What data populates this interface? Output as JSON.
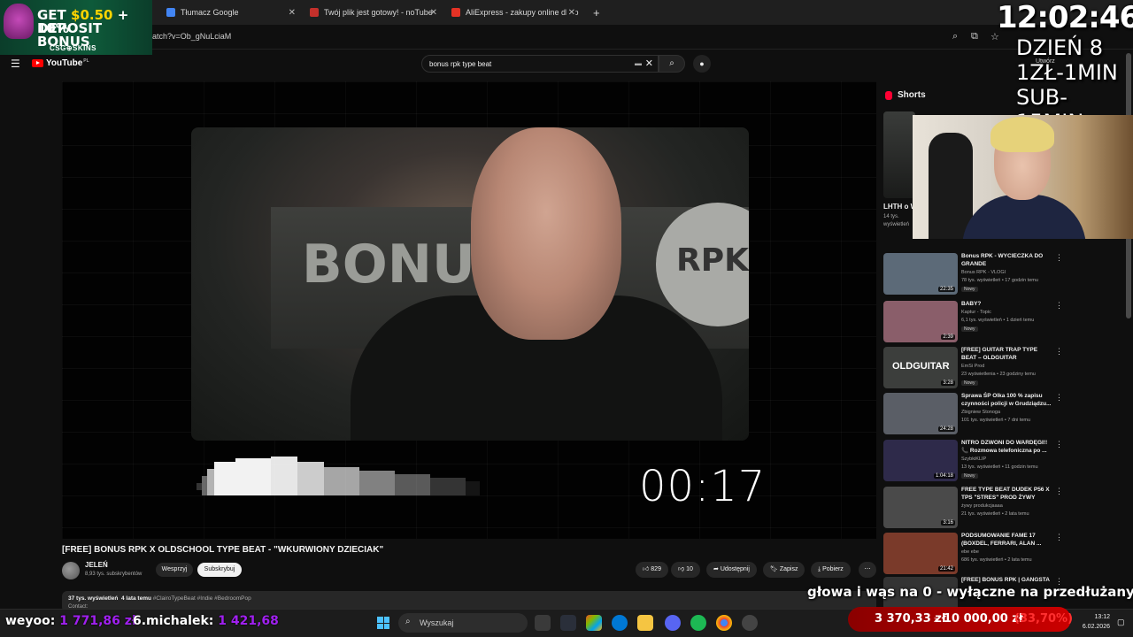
{
  "browser": {
    "tabs": [
      {
        "label": "Tłumacz Google",
        "color": "#4285f4"
      },
      {
        "label": "Twój plik jest gotowy! - noTube",
        "color": "#c4302b"
      },
      {
        "label": "AliExpress - zakupy online dla p",
        "color": "#e43225"
      }
    ],
    "url": "atch?v=Ob_gNuLciaM"
  },
  "youtube": {
    "logo": "YouTube",
    "region": "PL",
    "search_query": "bonus rpk type beat",
    "create_label": "Utwórz"
  },
  "player": {
    "timer": "00:17",
    "graffiti_left": "BONUS",
    "graffiti_right": "RPK"
  },
  "video": {
    "title": "[FREE] BONUS RPK X OLDSCHOOL TYPE BEAT - \"WKURWIONY DZIECIAK\"",
    "channel": "JELEŃ",
    "subscribers": "8,93 tys. subskrybentów",
    "join_label": "Wesprzyj",
    "subscribe_label": "Subskrybuj",
    "likes": "829",
    "dislikes": "10",
    "share_label": "Udostępnij",
    "save_label": "Zapisz",
    "download_label": "Pobierz",
    "more_label": "⋯",
    "views": "37 tys. wyświetleń",
    "age": "4 lata temu",
    "tags": "#ClairoTypeBeat #Indie #BedroomPop",
    "contact": "Contact:"
  },
  "sidebar": {
    "shorts_label": "Shorts",
    "short": {
      "title": "LHTH o W",
      "views": "14 tys. wyświetleń"
    },
    "recommendations": [
      {
        "title": "Bonus RPK - WYCIECZKA DO GRANDE",
        "channel": "Bonus RPK - VLOGI",
        "meta": "78 tys. wyświetleń • 17 godzin temu",
        "badge": "Nowy",
        "duration": "22:35",
        "thumb": "#5c6a78"
      },
      {
        "title": "BABY?",
        "channel": "Kaptur - Topic",
        "meta": "6,1 tys. wyświetleń • 1 dzień temu",
        "badge": "Nowy",
        "duration": "2:39",
        "thumb": "#8a5e6a"
      },
      {
        "title": "[FREE] GUITAR TRAP TYPE BEAT – OLDGUITAR",
        "channel": "EmSi Prod",
        "meta": "23 wyświetlenia • 23 godziny temu",
        "badge": "Nowy",
        "duration": "3:28",
        "thumb": "#3c3e3c",
        "thumb_text": "OLDGUITAR"
      },
      {
        "title": "Sprawa ŚP Olka 100 % zapisu czynności policji w Grudziądzu...",
        "channel": "Zbigniew Stonoga",
        "meta": "101 tys. wyświetleń • 7 dni temu",
        "badge": "",
        "duration": "24:28",
        "thumb": "#5a5e66"
      },
      {
        "title": "NITRO DZWONI DO WARDĘGI!! 📞 Rozmowa telefoniczna po ...",
        "channel": "SzybkiKLIP",
        "meta": "13 tys. wyświetleń • 11 godzin temu",
        "badge": "Nowy",
        "duration": "1:04:18",
        "thumb": "#2e2a4a"
      },
      {
        "title": "FREE TYPE BEAT DUDEK P56 X TPS \"STRES\" PROD ŻYWY",
        "channel": "żywy produkcjaaaa",
        "meta": "21 tys. wyświetleń • 2 lata temu",
        "badge": "",
        "duration": "3:16",
        "thumb": "#4a4a4a"
      },
      {
        "title": "PODSUMOWANIE FAME 17 (BOXDEL, FERRARI, ALAN ...",
        "channel": "ebe ebe",
        "meta": "686 tys. wyświetleń • 2 lata temu",
        "badge": "",
        "duration": "21:42",
        "thumb": "#7a3a2a"
      },
      {
        "title": "[FREE] BONUS RPK | GANGSTA",
        "channel": "",
        "meta": "",
        "badge": "",
        "duration": "",
        "thumb": "#333"
      }
    ]
  },
  "overlay": {
    "csg_line1_a": "GET ",
    "csg_amount": "$0.50",
    "csg_line1_b": " + 10%",
    "csg_line2": "DEPOSIT BONUS",
    "csg_brand": "CSG⊕SKINS",
    "clock": "12:02:46",
    "day": "DZIEŃ 8",
    "rate1": "1ZŁ-1MIN",
    "rate2": "SUB-15MIN",
    "chat": "głowa i wąs na 0 - wyłączne na przedłużanym",
    "donors": [
      {
        "name": "weyoo: ",
        "amount": "1 771,86 zł"
      },
      {
        "name": "6.michalek: ",
        "amount": "1 421,68"
      }
    ],
    "goal_current": "3 370,33 zł",
    "goal_sep": "z",
    "goal_target": "10 000,00 zł",
    "goal_pct": "(33,70%)",
    "goal_progress": 0.337
  },
  "taskbar": {
    "search_placeholder": "Wyszukaj",
    "time": "13:12",
    "date": "6.02.2026"
  }
}
